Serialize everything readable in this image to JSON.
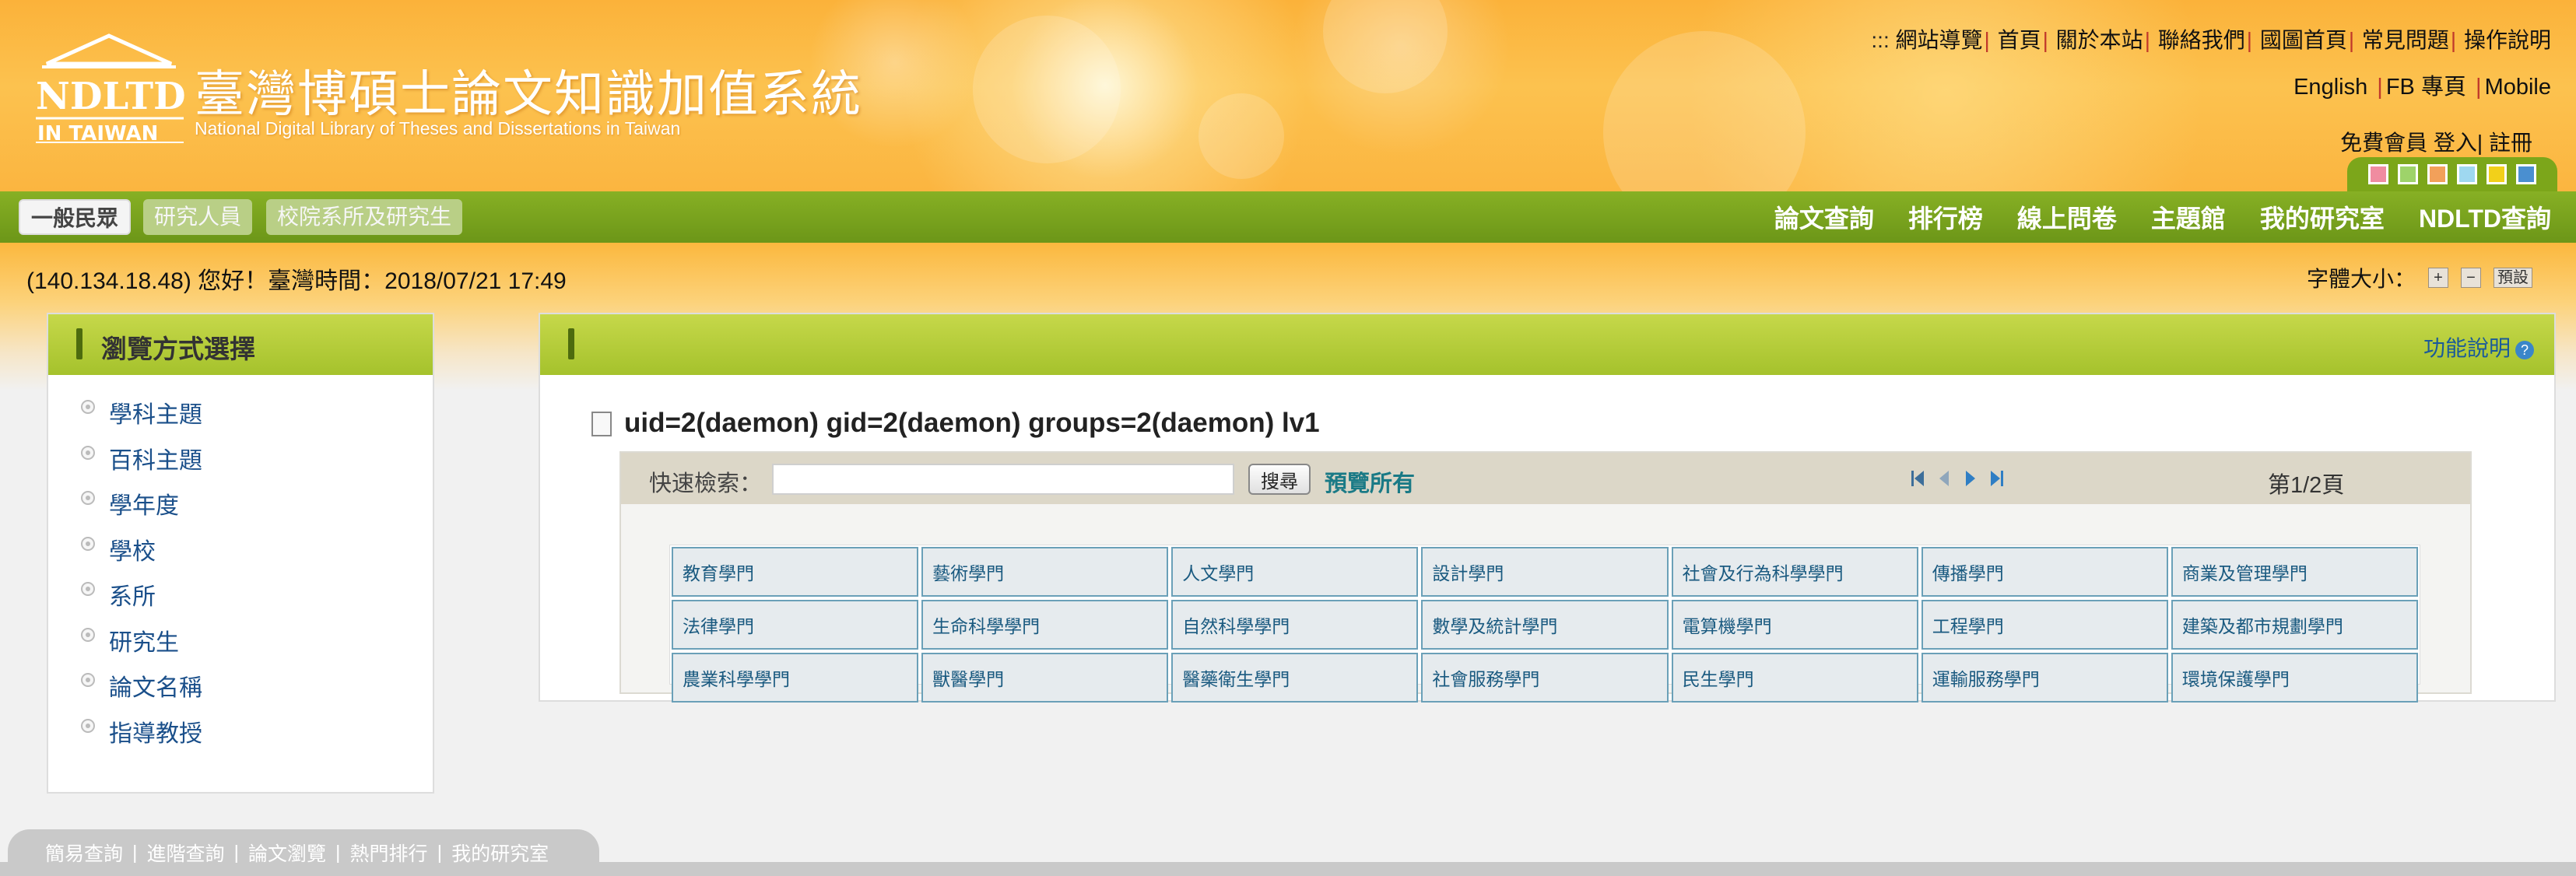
{
  "site": {
    "title_cn": "臺灣博碩士論文知識加值系統",
    "title_en": "National Digital Library of Theses and Dissertations in Taiwan",
    "logo_text": "NDLTD",
    "logo_sub": "IN TAIWAN"
  },
  "top_links": {
    "prefix": ":::",
    "items": [
      "網站導覽",
      "首頁",
      "關於本站",
      "聯絡我們",
      "國圖首頁",
      "常見問題",
      "操作說明"
    ]
  },
  "lang_links": [
    "English",
    "FB 專頁",
    "Mobile"
  ],
  "member_links": {
    "free_member": "免費會員",
    "login": "登入",
    "register": "註冊"
  },
  "theme_swatches": [
    "#f08ca0",
    "#9ed36a",
    "#f2a05a",
    "#9fd8f0",
    "#f2d01a",
    "#4a8fd0"
  ],
  "role_tabs": [
    "一般民眾",
    "研究人員",
    "校院系所及研究生"
  ],
  "main_menu": [
    "論文查詢",
    "排行榜",
    "線上問卷",
    "主題館",
    "我的研究室",
    "NDLTD查詢"
  ],
  "greeting": "(140.134.18.48) 您好！臺灣時間：2018/07/21 17:49",
  "font_size": {
    "label": "字體大小：",
    "increase": "+",
    "decrease": "−",
    "default": "預設"
  },
  "sidebar": {
    "title": "瀏覽方式選擇",
    "items": [
      "學科主題",
      "百科主題",
      "學年度",
      "學校",
      "系所",
      "研究生",
      "論文名稱",
      "指導教授"
    ]
  },
  "main": {
    "help_label": "功能說明",
    "result_title": "uid=2(daemon) gid=2(daemon) groups=2(daemon) lv1",
    "quick_search_label": "快速檢索：",
    "search_value": "",
    "search_button": "搜尋",
    "preview_all": "預覽所有",
    "page_info": "第1/2頁",
    "categories": [
      "教育學門",
      "藝術學門",
      "人文學門",
      "設計學門",
      "社會及行為科學學門",
      "傳播學門",
      "商業及管理學門",
      "法律學門",
      "生命科學學門",
      "自然科學學門",
      "數學及統計學門",
      "電算機學門",
      "工程學門",
      "建築及都市規劃學門",
      "農業科學學門",
      "獸醫學門",
      "醫藥衛生學門",
      "社會服務學門",
      "民生學門",
      "運輸服務學門",
      "環境保護學門"
    ]
  },
  "footer_links": [
    "簡易查詢",
    "進階查詢",
    "論文瀏覽",
    "熱門排行",
    "我的研究室"
  ]
}
